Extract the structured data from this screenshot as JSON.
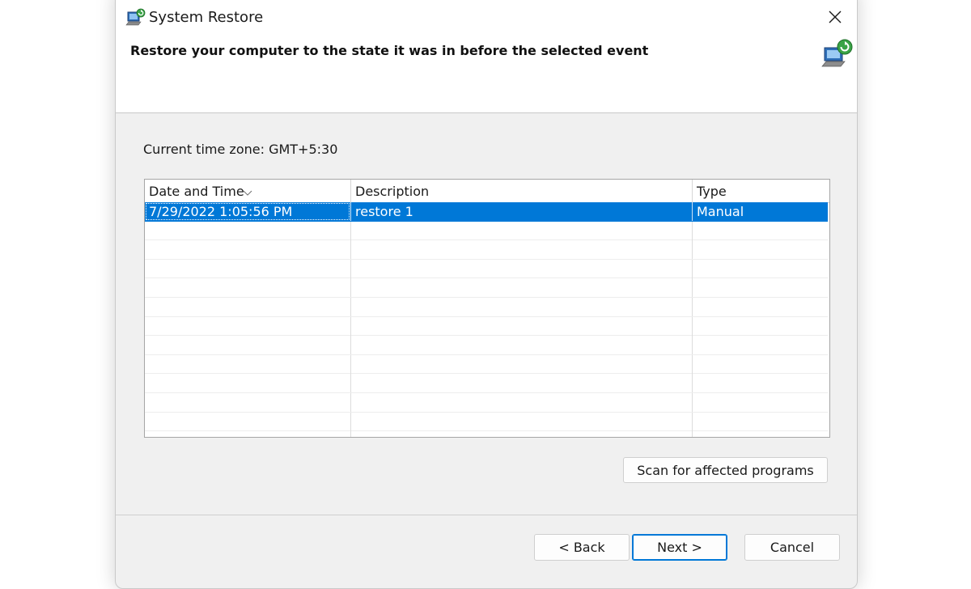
{
  "window": {
    "title": "System Restore",
    "heading": "Restore your computer to the state it was in before the selected event",
    "title_icon": "system-restore-icon",
    "header_icon": "system-restore-large-icon",
    "close_icon": "close-icon"
  },
  "timezone": {
    "label": "Current time zone: GMT+5:30"
  },
  "table": {
    "columns": [
      "Date and Time",
      "Description",
      "Type"
    ],
    "sorted_column": "Date and Time",
    "rows": [
      {
        "date_time": "7/29/2022 1:05:56 PM",
        "description": "restore 1",
        "type": "Manual",
        "selected": true
      }
    ]
  },
  "buttons": {
    "scan": "Scan for affected programs",
    "back": "< Back",
    "next": "Next >",
    "cancel": "Cancel"
  },
  "colors": {
    "selection": "#0078d7",
    "window_bg": "#f0f0f0",
    "header_bg": "#ffffff"
  }
}
